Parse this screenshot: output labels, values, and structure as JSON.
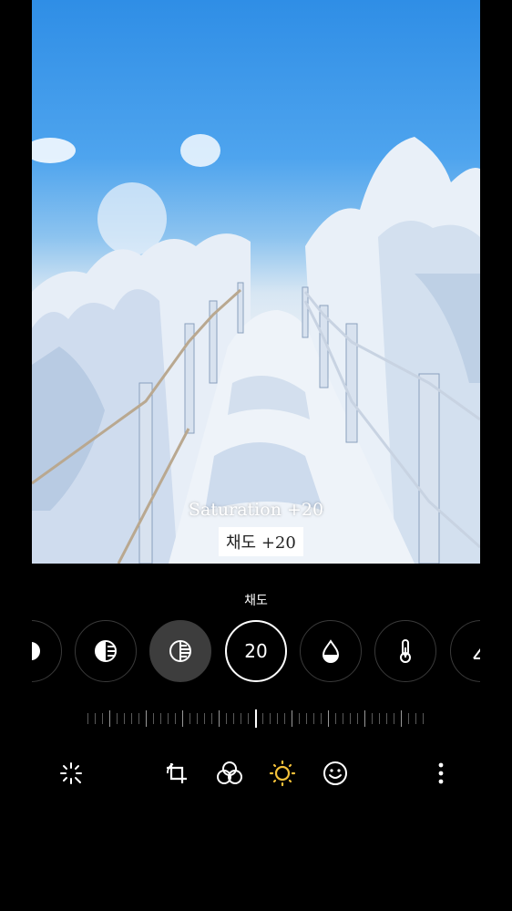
{
  "photo": {
    "caption_en": "Saturation +20",
    "caption_ko": "채도 +20"
  },
  "adjust": {
    "tool_label": "채도",
    "active_value": "20",
    "tools": [
      "brightness-icon",
      "exposure-icon",
      "contrast-icon",
      "saturation-icon",
      "tint-icon",
      "temperature-icon",
      "sharpness-icon"
    ]
  },
  "toolbar": {
    "items": [
      "auto-enhance-icon",
      "crop-rotate-icon",
      "filters-icon",
      "adjust-icon",
      "decorations-icon",
      "more-options-icon"
    ]
  },
  "colors": {
    "accent": "#f3c13a",
    "active_ring": "#ffffff",
    "ring": "#3a3a3a"
  }
}
